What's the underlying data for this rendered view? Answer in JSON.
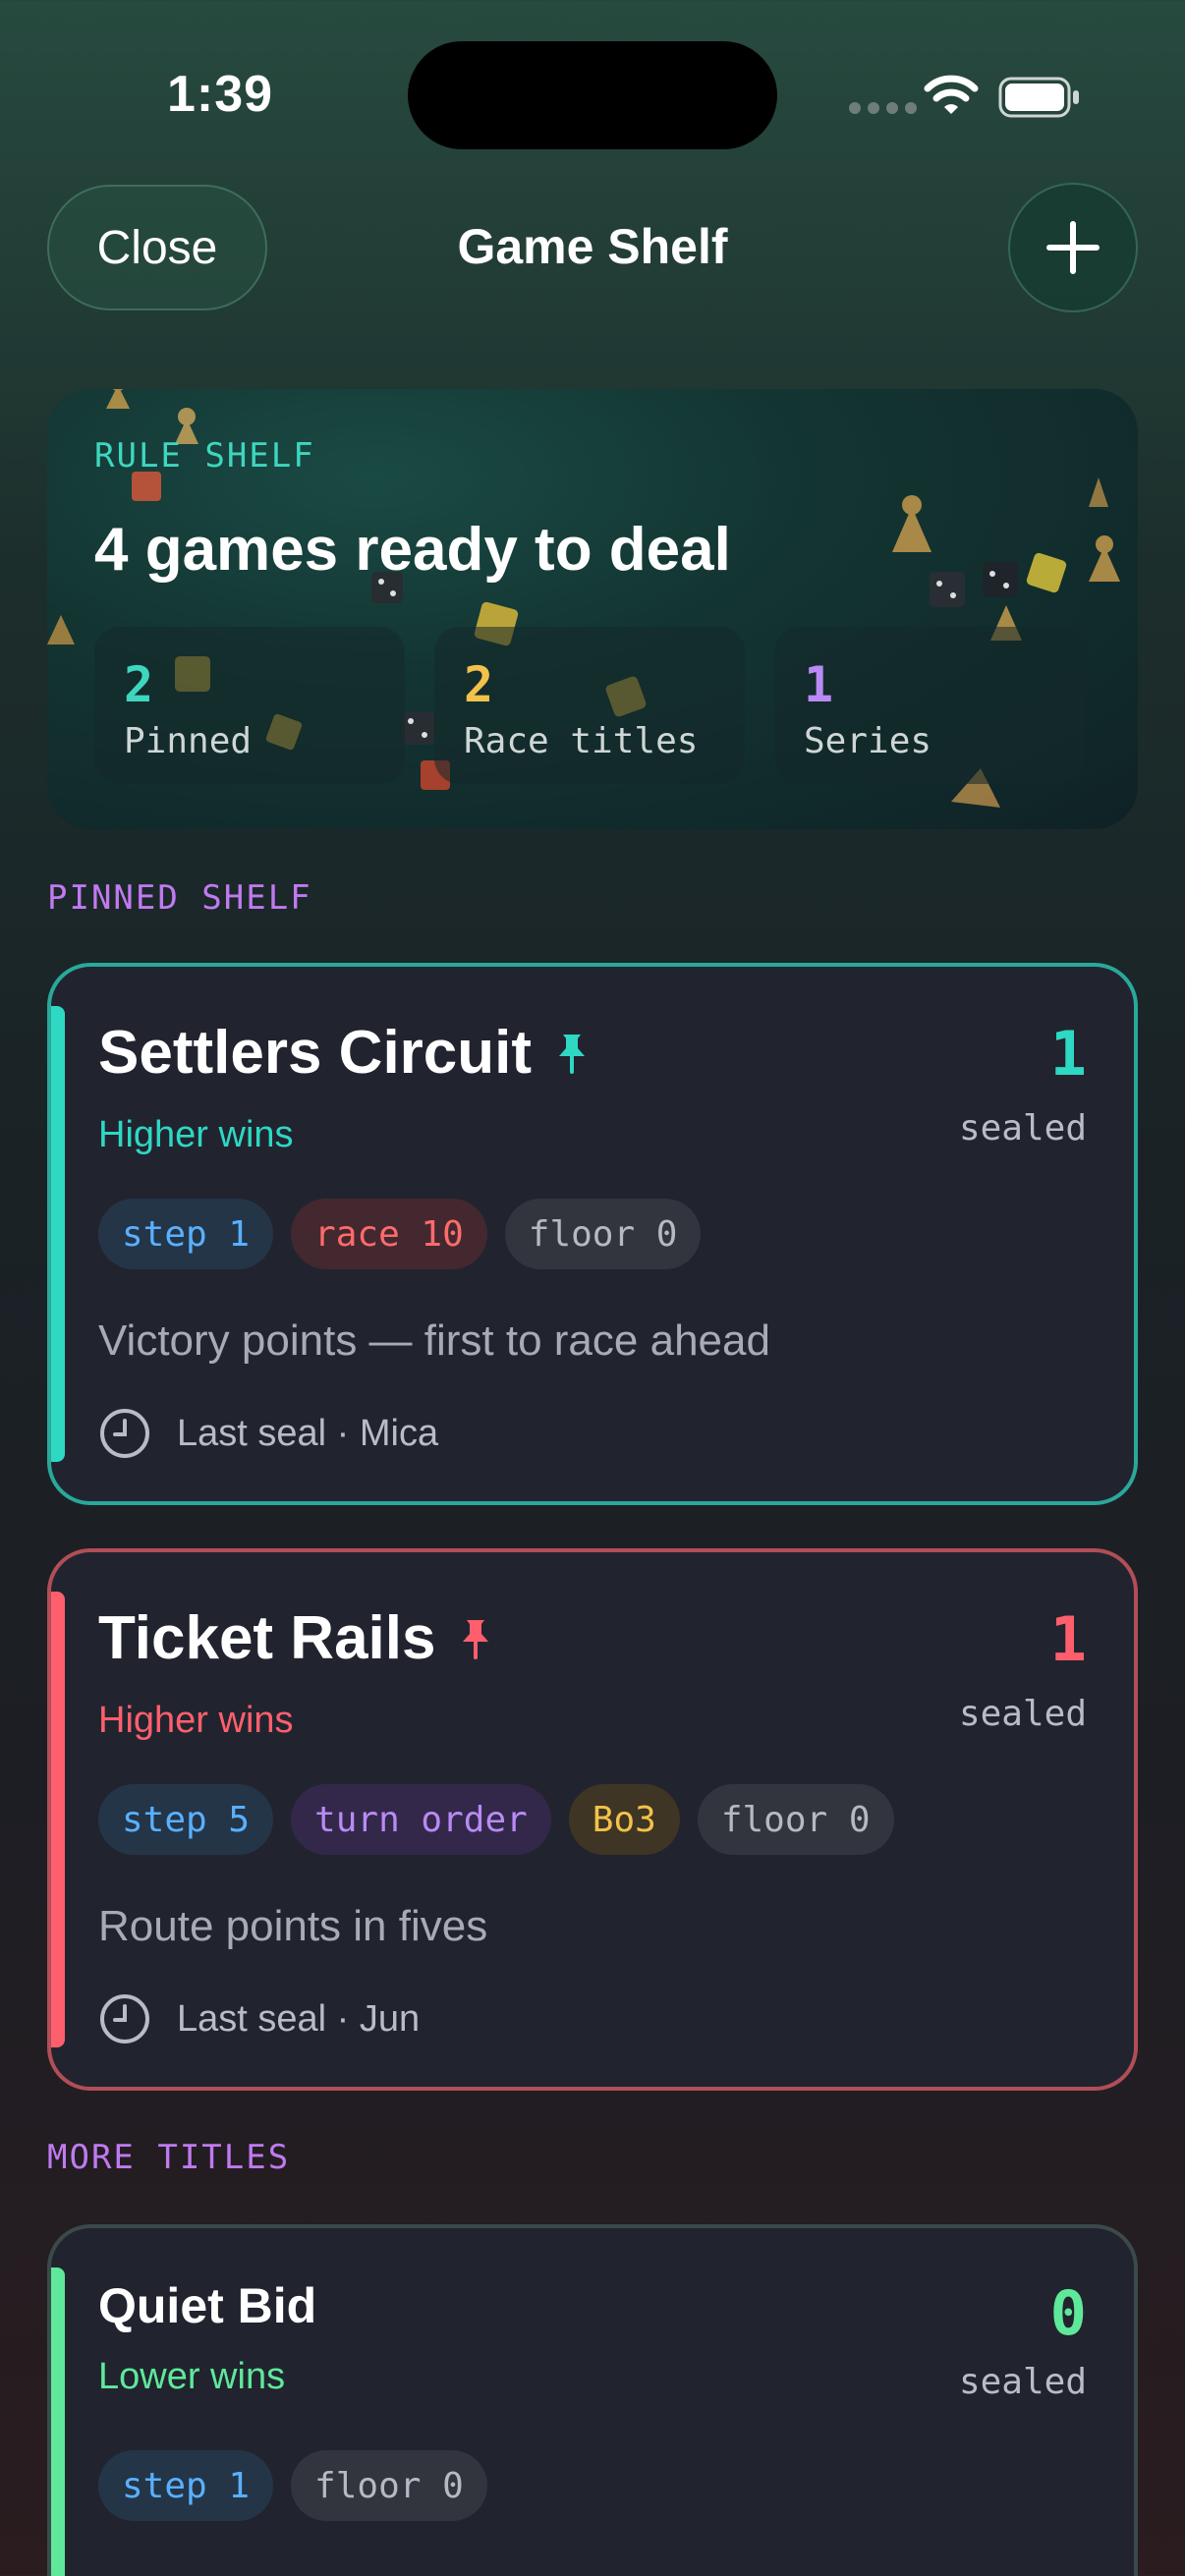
{
  "status_bar": {
    "time": "1:39"
  },
  "header": {
    "close_label": "Close",
    "title": "Game Shelf"
  },
  "hero": {
    "eyebrow": "RULE SHELF",
    "title": "4 games ready to deal",
    "stats": [
      {
        "value": "2",
        "label": "Pinned",
        "color": "#3ed6bf"
      },
      {
        "value": "2",
        "label": "Race titles",
        "color": "#f3c24a"
      },
      {
        "value": "1",
        "label": "Series",
        "color": "#b98af5"
      }
    ]
  },
  "sections": {
    "pinned_label": "PINNED SHELF",
    "more_label": "MORE TITLES"
  },
  "games": [
    {
      "title": "Settlers Circuit",
      "pinned": true,
      "rule": "Higher wins",
      "count": "1",
      "count_label": "sealed",
      "accent": "#2ed8c3",
      "chips": [
        {
          "label": "step 1",
          "style": "blue"
        },
        {
          "label": "race 10",
          "style": "red"
        },
        {
          "label": "floor 0",
          "style": "gray"
        }
      ],
      "description": "Victory points — first to race ahead",
      "last_seal": "Last seal · Mica"
    },
    {
      "title": "Ticket Rails",
      "pinned": true,
      "rule": "Higher wins",
      "count": "1",
      "count_label": "sealed",
      "accent": "#ff5f6d",
      "chips": [
        {
          "label": "step 5",
          "style": "blue"
        },
        {
          "label": "turn order",
          "style": "purple"
        },
        {
          "label": "Bo3",
          "style": "yellow"
        },
        {
          "label": "floor 0",
          "style": "gray"
        }
      ],
      "description": "Route points in fives",
      "last_seal": "Last seal · Jun"
    },
    {
      "title": "Quiet Bid",
      "pinned": false,
      "rule": "Lower wins",
      "count": "0",
      "count_label": "sealed",
      "accent": "#5fe89a",
      "chips": [
        {
          "label": "step 1",
          "style": "blue"
        },
        {
          "label": "floor 0",
          "style": "gray"
        }
      ]
    }
  ]
}
